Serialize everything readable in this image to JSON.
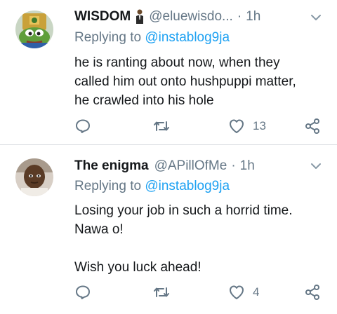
{
  "tweets": [
    {
      "name": "WISDOM",
      "emoji": "man-in-suit-emoji",
      "handle": "@eluewisdo...",
      "time": "1h",
      "replying_prefix": "Replying to ",
      "replying_to": "@instablog9ja",
      "lines": [
        "he is ranting about now, when they",
        "called him out onto hushpuppi matter,",
        "he crawled into his hole"
      ],
      "reply_count": "",
      "retweet_count": "",
      "like_count": "13",
      "avatar": "frog-avatar"
    },
    {
      "name": "The enigma",
      "handle": "@APillOfMe",
      "time": "1h",
      "replying_prefix": "Replying to ",
      "replying_to": "@instablog9ja",
      "lines": [
        "Losing your job in such a horrid time.",
        "Nawa o!",
        "",
        "Wish you luck ahead!"
      ],
      "reply_count": "",
      "retweet_count": "",
      "like_count": "4",
      "avatar": "child-avatar"
    }
  ],
  "colors": {
    "text": "#14171a",
    "secondary": "#657786",
    "link": "#1da1f2",
    "divider": "#d9dde1"
  }
}
